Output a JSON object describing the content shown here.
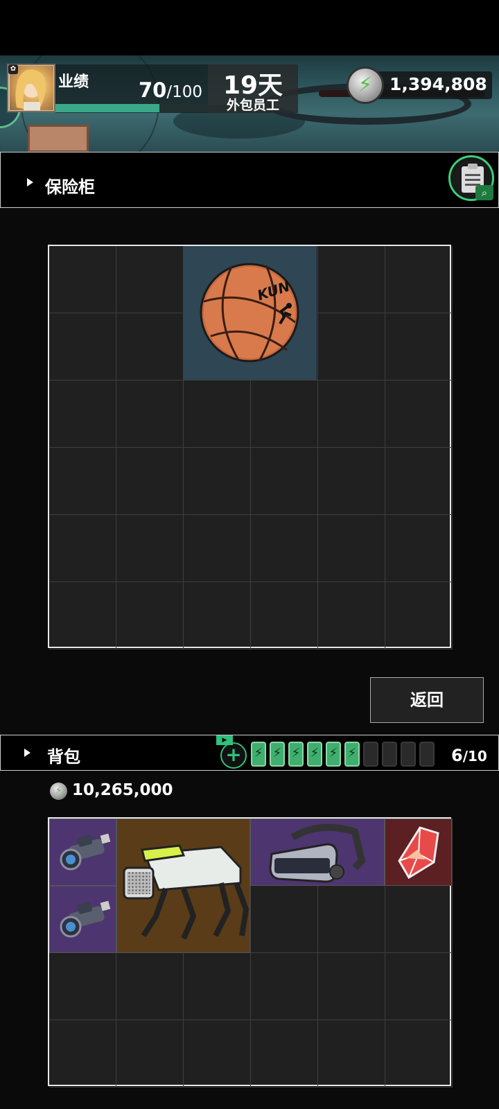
{
  "header": {
    "performance_label": "业绩",
    "performance_current": "70",
    "performance_max": "/100",
    "performance_fraction": 0.7,
    "days": "19天",
    "role": "外包员工",
    "coins": "1,394,808",
    "coin_icon": "lightning-coin-icon"
  },
  "safe": {
    "title": "保险柜",
    "items": [
      {
        "name": "basketball",
        "icon": "basketball-icon",
        "text": "KUN",
        "bg": "#2f4654"
      }
    ]
  },
  "actions": {
    "back_label": "返回"
  },
  "backpack": {
    "title": "背包",
    "capacity_current": "6",
    "capacity_max": "/10",
    "batteries_full": 6,
    "batteries_total": 10,
    "money": "10,265,000",
    "items": [
      {
        "name": "scope-1",
        "icon": "rifle-scope-icon",
        "bg": "#4d3570"
      },
      {
        "name": "scope-2",
        "icon": "rifle-scope-icon",
        "bg": "#4d3570"
      },
      {
        "name": "robot-dog",
        "icon": "robot-dog-icon",
        "bg": "#5a3c18"
      },
      {
        "name": "vr-headset",
        "icon": "vr-headset-icon",
        "bg": "#4d3570"
      },
      {
        "name": "crystal",
        "icon": "crystal-icon",
        "bg": "#5c1f22"
      }
    ]
  }
}
